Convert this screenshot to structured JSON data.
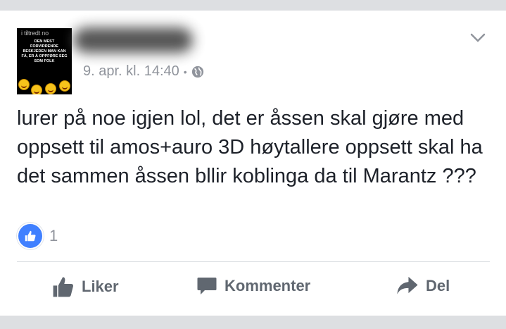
{
  "post": {
    "avatar": {
      "top_text": "i tiltredt no",
      "image_text": "DEN MEST FORVIRRENDE BESKJEDEN MAN KAN FÅ, ER Å OPPFØRE SEG SOM FOLK"
    },
    "timestamp": "9. apr. kl. 14:40",
    "separator": "•",
    "text": "lurer på noe igjen lol, det er åssen skal gjøre med oppsett til amos+auro 3D høytallere oppsett skal ha det sammen åssen bllir koblinga da til Marantz ???",
    "reaction_count": "1"
  },
  "actions": {
    "like_label": "Liker",
    "comment_label": "Kommenter",
    "share_label": "Del"
  },
  "colors": {
    "background": "#dddfe2",
    "like_blue": "#4080ff",
    "text": "#1d2129",
    "muted": "#90949c",
    "action": "#606770"
  },
  "icons": [
    "globe-icon",
    "chevron-down-icon",
    "like-reaction-icon",
    "thumbs-up-icon",
    "comment-icon",
    "share-icon"
  ]
}
